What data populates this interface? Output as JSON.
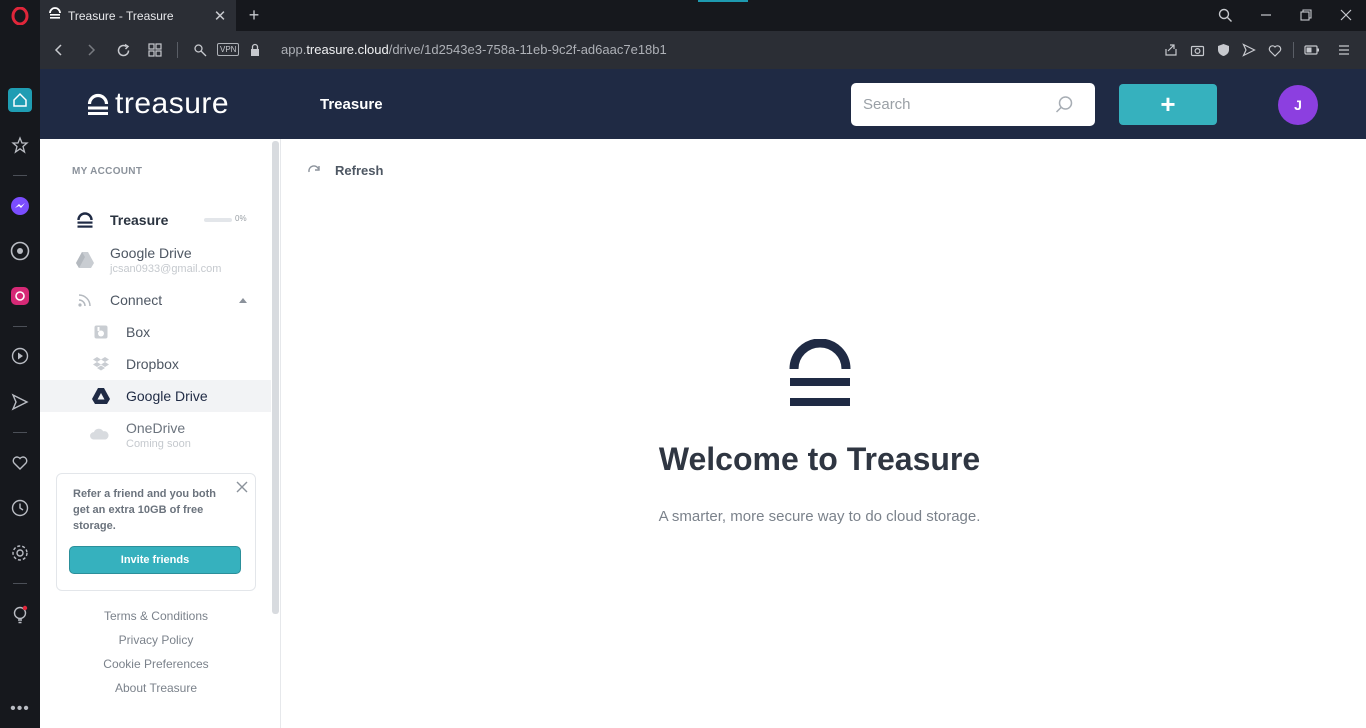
{
  "browser": {
    "tab_title": "Treasure - Treasure",
    "url_prefix": "app.",
    "url_domain": "treasure.cloud",
    "url_path": "/drive/1d2543e3-758a-11eb-9c2f-ad6aac7e18b1",
    "vpn_label": "VPN"
  },
  "header": {
    "logo_text": "treasure",
    "title": "Treasure",
    "search_placeholder": "Search",
    "add_label": "+",
    "avatar_initial": "J"
  },
  "sidebar": {
    "section_label": "MY ACCOUNT",
    "treasure": {
      "label": "Treasure",
      "usage_pct": "0%",
      "usage_value": 0
    },
    "google_drive_account": {
      "label": "Google Drive",
      "email": "jcsan0933@gmail.com"
    },
    "connect": {
      "label": "Connect"
    },
    "connect_items": [
      {
        "label": "Box",
        "icon": "box-icon"
      },
      {
        "label": "Dropbox",
        "icon": "dropbox-icon"
      },
      {
        "label": "Google Drive",
        "icon": "google-drive-icon"
      },
      {
        "label": "OneDrive",
        "sub": "Coming soon",
        "icon": "onedrive-icon"
      }
    ],
    "promo": {
      "text": "Refer a friend and you both get an extra 10GB of free storage.",
      "button": "Invite friends"
    },
    "footer_links": [
      "Terms & Conditions",
      "Privacy Policy",
      "Cookie Preferences",
      "About Treasure"
    ]
  },
  "main": {
    "refresh_label": "Refresh",
    "welcome_title": "Welcome to Treasure",
    "welcome_subtitle": "A smarter, more secure way to do cloud storage."
  },
  "colors": {
    "header_bg": "#1f2a44",
    "accent": "#36b1be",
    "avatar": "#8c3fe0"
  }
}
